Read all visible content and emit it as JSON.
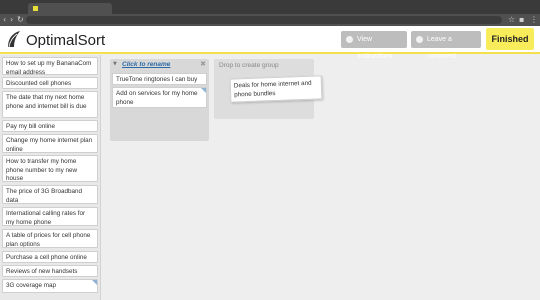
{
  "header": {
    "app_name": "OptimalSort",
    "view_instructions": "View instructions",
    "leave_comment": "Leave a comment",
    "finished": "Finished"
  },
  "cards": [
    "How to set up my BananaCom email address",
    "Discounted cell phones",
    "The date that my next home phone and internet bill is due",
    "Pay my bill online",
    "Change my home internet plan online",
    "How to transfer my home phone number to my new house",
    "The price of 3G Broadband data",
    "International calling rates for my home phone",
    "A table of prices for cell phone plan options",
    "Purchase a cell phone online",
    "Reviews of new handsets",
    "3G coverage map"
  ],
  "group": {
    "title": "Click to rename",
    "cards": [
      "TrueTone ringtones I can buy",
      "Add on services for my home phone"
    ]
  },
  "dropzone": {
    "label": "Drop to create group"
  },
  "dragging_card": "Deals for home internet and phone bundles"
}
